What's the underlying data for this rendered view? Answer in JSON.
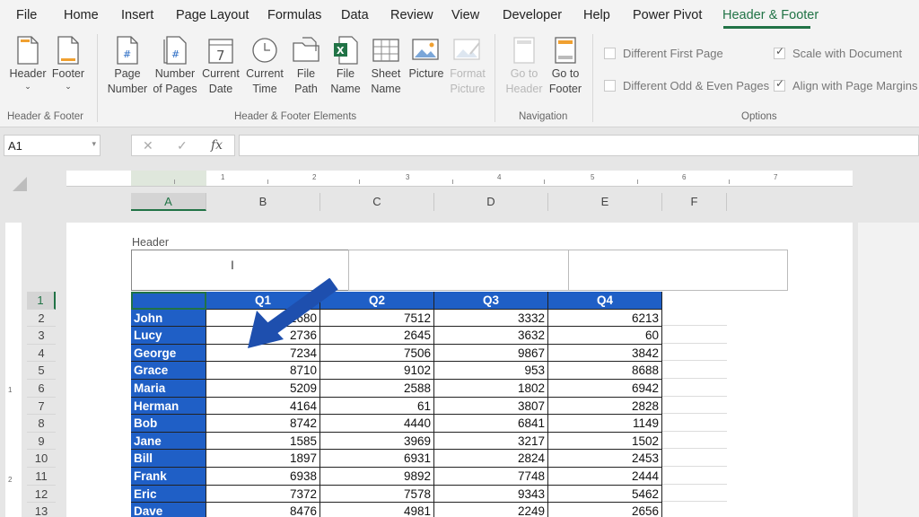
{
  "menu": {
    "items": [
      "File",
      "Home",
      "Insert",
      "Page Layout",
      "Formulas",
      "Data",
      "Review",
      "View",
      "Developer",
      "Help",
      "Power Pivot",
      "Header & Footer"
    ],
    "active": "Header & Footer"
  },
  "ribbon": {
    "groups": {
      "header_footer": "Header & Footer",
      "elements": "Header & Footer Elements",
      "navigation": "Navigation",
      "options": "Options"
    },
    "buttons": {
      "header": "Header",
      "footer": "Footer",
      "page_number": "Page\nNumber",
      "number_of_pages": "Number\nof Pages",
      "current_date": "Current\nDate",
      "current_time": "Current\nTime",
      "file_path": "File\nPath",
      "file_name": "File\nName",
      "sheet_name": "Sheet\nName",
      "picture": "Picture",
      "format_picture": "Format\nPicture",
      "go_to_header": "Go to\nHeader",
      "go_to_footer": "Go to\nFooter"
    },
    "options": {
      "different_first_page": "Different First Page",
      "different_odd_even": "Different Odd & Even Pages",
      "scale_with_document": "Scale with Document",
      "align_with_margins": "Align with Page Margins"
    }
  },
  "formula_bar": {
    "name_box": "A1",
    "cancel_symbol": "✕",
    "enter_symbol": "✓",
    "fx_symbol": "fx",
    "formula": ""
  },
  "ruler": [
    "1",
    "2",
    "3",
    "4",
    "5",
    "6",
    "7"
  ],
  "vruler": [
    "1",
    "2"
  ],
  "columns": [
    "A",
    "B",
    "C",
    "D",
    "E",
    "F"
  ],
  "header_area": {
    "label": "Header",
    "cursor": "I"
  },
  "rows": [
    "1",
    "2",
    "3",
    "4",
    "5",
    "6",
    "7",
    "8",
    "9",
    "10",
    "11",
    "12",
    "13"
  ],
  "table": {
    "headers": [
      "",
      "Q1",
      "Q2",
      "Q3",
      "Q4"
    ],
    "records": [
      {
        "name": "John",
        "q": [
          2680,
          7512,
          3332,
          6213
        ]
      },
      {
        "name": "Lucy",
        "q": [
          2736,
          2645,
          3632,
          60
        ]
      },
      {
        "name": "George",
        "q": [
          7234,
          7506,
          9867,
          3842
        ]
      },
      {
        "name": "Grace",
        "q": [
          8710,
          9102,
          953,
          8688
        ]
      },
      {
        "name": "Maria",
        "q": [
          5209,
          2588,
          1802,
          6942
        ]
      },
      {
        "name": "Herman",
        "q": [
          4164,
          61,
          3807,
          2828
        ]
      },
      {
        "name": "Bob",
        "q": [
          8742,
          4440,
          6841,
          1149
        ]
      },
      {
        "name": "Jane",
        "q": [
          1585,
          3969,
          3217,
          1502
        ]
      },
      {
        "name": "Bill",
        "q": [
          1897,
          6931,
          2824,
          2453
        ]
      },
      {
        "name": "Frank",
        "q": [
          6938,
          9892,
          7748,
          2444
        ]
      },
      {
        "name": "Eric",
        "q": [
          7372,
          7578,
          9343,
          5462
        ]
      },
      {
        "name": "Dave",
        "q": [
          8476,
          4981,
          2249,
          2656
        ]
      }
    ]
  },
  "colors": {
    "accent": "#217346",
    "table_fill": "#1f5fc6",
    "arrow": "#1e4fae"
  }
}
